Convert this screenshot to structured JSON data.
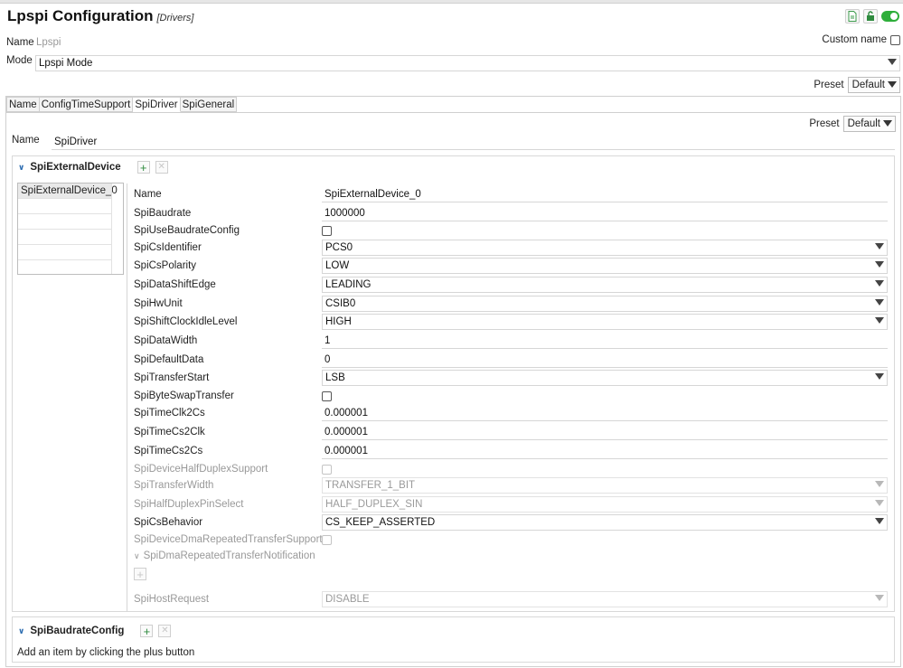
{
  "header": {
    "title": "Lpspi Configuration",
    "subtitle": "[Drivers]"
  },
  "top_icons": [
    "document-icon",
    "unlock-icon",
    "toggle-on-icon"
  ],
  "name_row": {
    "label": "Name",
    "value": "Lpspi",
    "custom_name_label": "Custom name"
  },
  "mode_row": {
    "label": "Mode",
    "value": "Lpspi Mode"
  },
  "preset_top": {
    "label": "Preset",
    "value": "Default"
  },
  "tabs": [
    "Name",
    "ConfigTimeSupport",
    "SpiDriver",
    "SpiGeneral"
  ],
  "active_tab": "SpiDriver",
  "preset_inner": {
    "label": "Preset",
    "value": "Default"
  },
  "driver_name": {
    "label": "Name",
    "value": "SpiDriver"
  },
  "external_device": {
    "title": "SpiExternalDevice",
    "list": [
      "SpiExternalDevice_0"
    ],
    "props": [
      {
        "label": "Name",
        "type": "text",
        "value": "SpiExternalDevice_0",
        "disabled": false
      },
      {
        "label": "SpiBaudrate",
        "type": "text",
        "value": "1000000",
        "disabled": false
      },
      {
        "label": "SpiUseBaudrateConfig",
        "type": "check",
        "value": "",
        "disabled": false
      },
      {
        "label": "SpiCsIdentifier",
        "type": "select",
        "value": "PCS0",
        "disabled": false
      },
      {
        "label": "SpiCsPolarity",
        "type": "select",
        "value": "LOW",
        "disabled": false
      },
      {
        "label": "SpiDataShiftEdge",
        "type": "select",
        "value": "LEADING",
        "disabled": false
      },
      {
        "label": "SpiHwUnit",
        "type": "select",
        "value": "CSIB0",
        "disabled": false
      },
      {
        "label": "SpiShiftClockIdleLevel",
        "type": "select",
        "value": "HIGH",
        "disabled": false
      },
      {
        "label": "SpiDataWidth",
        "type": "text",
        "value": "1",
        "disabled": false
      },
      {
        "label": "SpiDefaultData",
        "type": "text",
        "value": "0",
        "disabled": false
      },
      {
        "label": "SpiTransferStart",
        "type": "select",
        "value": "LSB",
        "disabled": false
      },
      {
        "label": "SpiByteSwapTransfer",
        "type": "check",
        "value": "",
        "disabled": false
      },
      {
        "label": "SpiTimeClk2Cs",
        "type": "text",
        "value": "0.000001",
        "disabled": false
      },
      {
        "label": "SpiTimeCs2Clk",
        "type": "text",
        "value": "0.000001",
        "disabled": false
      },
      {
        "label": "SpiTimeCs2Cs",
        "type": "text",
        "value": "0.000001",
        "disabled": false
      },
      {
        "label": "SpiDeviceHalfDuplexSupport",
        "type": "check",
        "value": "",
        "disabled": true
      },
      {
        "label": "SpiTransferWidth",
        "type": "select",
        "value": "TRANSFER_1_BIT",
        "disabled": true
      },
      {
        "label": "SpiHalfDuplexPinSelect",
        "type": "select",
        "value": "HALF_DUPLEX_SIN",
        "disabled": true
      },
      {
        "label": "SpiCsBehavior",
        "type": "select",
        "value": "CS_KEEP_ASSERTED",
        "disabled": false
      },
      {
        "label": "SpiDeviceDmaRepeatedTransferSupport",
        "type": "check",
        "value": "",
        "disabled": true
      }
    ],
    "dma_notification_label": "SpiDmaRepeatedTransferNotification",
    "host_request": {
      "label": "SpiHostRequest",
      "value": "DISABLE"
    }
  },
  "baudrate_config": {
    "title": "SpiBaudrateConfig",
    "hint": "Add an item by clicking the plus button"
  }
}
